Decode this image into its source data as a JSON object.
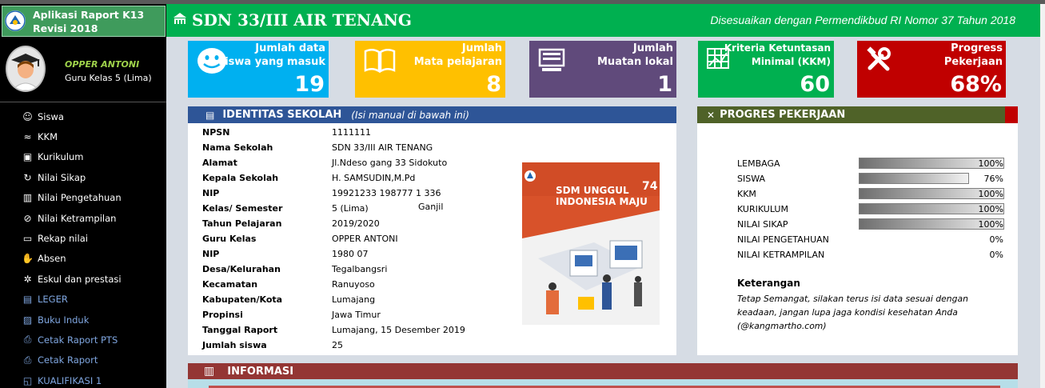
{
  "app": {
    "title": "Aplikasi Raport K13 Revisi 2018"
  },
  "user": {
    "name": "OPPER ANTONI",
    "role": "Guru Kelas 5 (Lima)"
  },
  "nav": [
    {
      "label": "Siswa",
      "icon": "smiley-icon",
      "glyph": "☺",
      "style": "white"
    },
    {
      "label": "KKM",
      "icon": "wave-icon",
      "glyph": "≈",
      "style": "white"
    },
    {
      "label": "Kurikulum",
      "icon": "window-icon",
      "glyph": "▣",
      "style": "white"
    },
    {
      "label": "Nilai Sikap",
      "icon": "refresh-icon",
      "glyph": "↻",
      "style": "white"
    },
    {
      "label": "Nilai Pengetahuan",
      "icon": "book-icon",
      "glyph": "▥",
      "style": "white"
    },
    {
      "label": "Nilai Ketrampilan",
      "icon": "eye-slash-icon",
      "glyph": "⊘",
      "style": "white"
    },
    {
      "label": "Rekap nilai",
      "icon": "folder-icon",
      "glyph": "▭",
      "style": "white"
    },
    {
      "label": "Absen",
      "icon": "hand-icon",
      "glyph": "✋",
      "style": "white"
    },
    {
      "label": "Eskul dan prestasi",
      "icon": "gear-icon",
      "glyph": "✲",
      "style": "white"
    },
    {
      "label": "LEGER",
      "icon": "table-icon",
      "glyph": "▤",
      "style": "blue"
    },
    {
      "label": "Buku Induk",
      "icon": "image-icon",
      "glyph": "▨",
      "style": "blue"
    },
    {
      "label": "Cetak Raport PTS",
      "icon": "printer-icon",
      "glyph": "⎙",
      "style": "blue"
    },
    {
      "label": "Cetak Raport",
      "icon": "printer-icon",
      "glyph": "⎙",
      "style": "blue"
    },
    {
      "label": "KUALIFIKASI 1",
      "icon": "chart-icon",
      "glyph": "◱",
      "style": "blue"
    }
  ],
  "header": {
    "school": "SDN 33/III AIR TENANG",
    "subtitle": "Disesuaikan dengan Permendikbud RI Nomor 37 Tahun 2018",
    "icon": "school-icon"
  },
  "cards": [
    {
      "label_line1": "Jumlah data",
      "label_line2": "siswa yang masuk",
      "value": "19",
      "color": "#00b0f0",
      "icon": "smiley-icon"
    },
    {
      "label_line1": "Jumlah",
      "label_line2": "Mata pelajaran",
      "value": "8",
      "color": "#ffc000",
      "icon": "book-icon"
    },
    {
      "label_line1": "Jumlah",
      "label_line2": "Muatan lokal",
      "value": "1",
      "color": "#604a7b",
      "icon": "monitor-icon"
    },
    {
      "label_line1": "Kriteria Ketuntasan",
      "label_line2": "Minimal (KKM)",
      "value": "60",
      "color": "#00b050",
      "icon": "table-icon"
    },
    {
      "label_line1": "Progress",
      "label_line2": "Pekerjaan",
      "value": "68%",
      "color": "#c00000",
      "icon": "tools-icon"
    }
  ],
  "identitas": {
    "title": "IDENTITAS SEKOLAH",
    "note": "(Isi manual di bawah ini)",
    "rows": [
      {
        "key": "NPSN",
        "value": "1111111"
      },
      {
        "key": "Nama Sekolah",
        "value": "SDN 33/III AIR TENANG"
      },
      {
        "key": "Alamat",
        "value": "Jl.Ndeso gang 33 Sidokuto"
      },
      {
        "key": "Kepala Sekolah",
        "value": "H. SAMSUDIN,M.Pd"
      },
      {
        "key": "NIP",
        "value": "19921233 198777 1 336"
      },
      {
        "key": "Kelas/ Semester",
        "value": "5 (Lima)",
        "value2": "Ganjil"
      },
      {
        "key": "Tahun Pelajaran",
        "value": "2019/2020"
      },
      {
        "key": "Guru Kelas",
        "value": "OPPER ANTONI"
      },
      {
        "key": "NIP",
        "value": "1980 07"
      },
      {
        "key": "Desa/Kelurahan",
        "value": "Tegalbangsri"
      },
      {
        "key": "Kecamatan",
        "value": "Ranuyoso"
      },
      {
        "key": "Kabupaten/Kota",
        "value": "Lumajang"
      },
      {
        "key": "Propinsi",
        "value": "Jawa Timur"
      },
      {
        "key": "Tanggal Raport",
        "value": "Lumajang, 15 Desember 2019"
      },
      {
        "key": "Jumlah siswa",
        "value": "25"
      }
    ],
    "poster_line1": "SDM UNGGUL",
    "poster_line2": "INDONESIA MAJU",
    "poster_badge": "74"
  },
  "progres": {
    "title": "PROGRES PEKERJAAN",
    "items": [
      {
        "label": "LEMBAGA",
        "percent": 100,
        "text": "100%"
      },
      {
        "label": "SISWA",
        "percent": 76,
        "text": "76%"
      },
      {
        "label": "KKM",
        "percent": 100,
        "text": "100%"
      },
      {
        "label": "KURIKULUM",
        "percent": 100,
        "text": "100%"
      },
      {
        "label": "NILAI SIKAP",
        "percent": 100,
        "text": "100%"
      },
      {
        "label": "NILAI PENGETAHUAN",
        "percent": 0,
        "text": "0%"
      },
      {
        "label": "NILAI KETRAMPILAN",
        "percent": 0,
        "text": "0%"
      }
    ],
    "keterangan_title": "Keterangan",
    "keterangan_text": " Tetap Semangat, silakan terus isi data sesuai dengan keadaan, jangan lupa jaga kondisi kesehatan Anda (@kangmartho.com)"
  },
  "informasi": {
    "title": "INFORMASI"
  }
}
